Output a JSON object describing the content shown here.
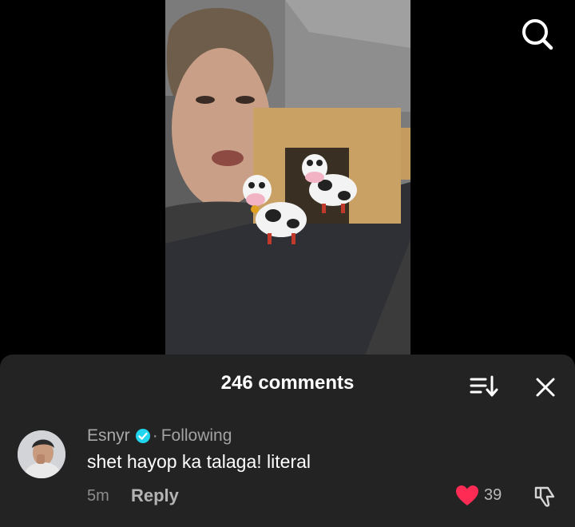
{
  "comments_panel": {
    "title": "246 comments"
  },
  "comment": {
    "author": "Esnyr",
    "separator": "·",
    "relationship": "Following",
    "text": "shet hayop ka talaga! literal",
    "time": "5m",
    "reply_label": "Reply",
    "like_count": "39",
    "liked": true
  },
  "icons": {
    "search": "search-icon",
    "sort": "sort-icon",
    "close": "close-icon",
    "verified": "verified-badge-icon",
    "like": "heart-icon",
    "dislike": "dislike-icon"
  },
  "colors": {
    "panel_background": "#232323",
    "heart": "#fe2c55",
    "verified": "#20d5ec"
  }
}
